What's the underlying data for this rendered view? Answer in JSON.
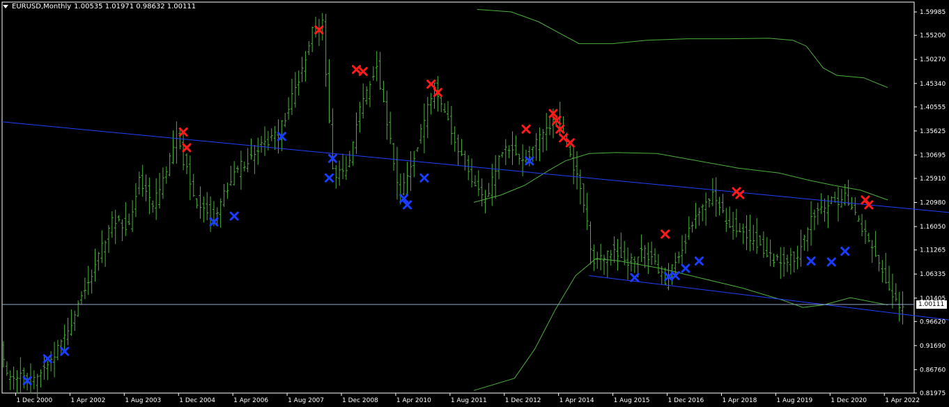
{
  "header": {
    "symbol": "EURUSD,Monthly",
    "ohlc": "1.00535 1.01971 0.98632 1.00111"
  },
  "current_price": "1.00111",
  "colors": {
    "background": "#000000",
    "candles": "#4caf3c",
    "bands": "#4caf3c",
    "channel": "#2040ff",
    "price_line": "#8fa8c8",
    "sell_marker": "#ff1a1a",
    "buy_marker": "#1a3cff",
    "axis": "#ffffff"
  },
  "chart_data": {
    "type": "bar",
    "title": "EURUSD,Monthly",
    "ylim": [
      0.8197,
      1.62
    ],
    "y_ticks": [
      "1.59985",
      "1.55200",
      "1.50270",
      "1.45340",
      "1.40555",
      "1.35625",
      "1.30695",
      "1.25910",
      "1.20980",
      "1.16050",
      "1.11265",
      "1.06335",
      "1.01405",
      "0.96620",
      "0.91690",
      "0.86760",
      "0.81975"
    ],
    "x_ticks": [
      "1 Dec 2000",
      "1 Apr 2002",
      "1 Aug 2003",
      "1 Dec 2004",
      "1 Apr 2006",
      "1 Aug 2007",
      "1 Dec 2008",
      "1 Apr 2010",
      "1 Aug 2011",
      "1 Dec 2012",
      "1 Apr 2014",
      "1 Aug 2015",
      "1 Dec 2016",
      "1 Apr 2018",
      "1 Aug 2019",
      "1 Dec 2020",
      "1 Apr 2022"
    ],
    "x_start": "2000-08",
    "x_end": "2022-09",
    "price_anchors": [
      [
        "2000-08",
        0.91
      ],
      [
        "2000-10",
        0.86
      ],
      [
        "2001-06",
        0.85
      ],
      [
        "2001-12",
        0.9
      ],
      [
        "2002-06",
        0.98
      ],
      [
        "2003-05",
        1.17
      ],
      [
        "2003-10",
        1.16
      ],
      [
        "2004-01",
        1.26
      ],
      [
        "2004-05",
        1.2
      ],
      [
        "2004-12",
        1.34
      ],
      [
        "2005-06",
        1.21
      ],
      [
        "2005-11",
        1.18
      ],
      [
        "2006-05",
        1.27
      ],
      [
        "2006-12",
        1.32
      ],
      [
        "2007-06",
        1.35
      ],
      [
        "2007-12",
        1.46
      ],
      [
        "2008-04",
        1.56
      ],
      [
        "2008-07",
        1.58
      ],
      [
        "2008-10",
        1.27
      ],
      [
        "2009-02",
        1.27
      ],
      [
        "2009-06",
        1.4
      ],
      [
        "2009-11",
        1.49
      ],
      [
        "2010-06",
        1.22
      ],
      [
        "2010-11",
        1.33
      ],
      [
        "2011-04",
        1.45
      ],
      [
        "2011-12",
        1.3
      ],
      [
        "2012-07",
        1.21
      ],
      [
        "2012-12",
        1.32
      ],
      [
        "2013-07",
        1.3
      ],
      [
        "2014-03",
        1.38
      ],
      [
        "2014-06",
        1.36
      ],
      [
        "2014-12",
        1.21
      ],
      [
        "2015-03",
        1.08
      ],
      [
        "2015-08",
        1.11
      ],
      [
        "2016-01",
        1.09
      ],
      [
        "2016-06",
        1.11
      ],
      [
        "2016-12",
        1.05
      ],
      [
        "2017-05",
        1.12
      ],
      [
        "2017-09",
        1.18
      ],
      [
        "2018-02",
        1.23
      ],
      [
        "2018-06",
        1.17
      ],
      [
        "2019-01",
        1.14
      ],
      [
        "2019-09",
        1.09
      ],
      [
        "2020-03",
        1.1
      ],
      [
        "2020-07",
        1.18
      ],
      [
        "2021-01",
        1.21
      ],
      [
        "2021-05",
        1.22
      ],
      [
        "2021-12",
        1.13
      ],
      [
        "2022-05",
        1.05
      ],
      [
        "2022-09",
        1.0
      ]
    ],
    "upper_band": [
      [
        "2012-04",
        1.605
      ],
      [
        "2013-02",
        1.6
      ],
      [
        "2013-10",
        1.58
      ],
      [
        "2014-06",
        1.55
      ],
      [
        "2014-10",
        1.535
      ],
      [
        "2015-08",
        1.535
      ],
      [
        "2016-06",
        1.542
      ],
      [
        "2017-06",
        1.545
      ],
      [
        "2018-06",
        1.545
      ],
      [
        "2019-06",
        1.546
      ],
      [
        "2020-01",
        1.542
      ],
      [
        "2020-05",
        1.53
      ],
      [
        "2020-10",
        1.485
      ],
      [
        "2021-02",
        1.47
      ],
      [
        "2021-10",
        1.465
      ],
      [
        "2022-05",
        1.445
      ]
    ],
    "middle_band": [
      [
        "2012-03",
        1.21
      ],
      [
        "2012-11",
        1.225
      ],
      [
        "2013-06",
        1.245
      ],
      [
        "2014-01",
        1.275
      ],
      [
        "2014-06",
        1.295
      ],
      [
        "2015-01",
        1.31
      ],
      [
        "2015-09",
        1.312
      ],
      [
        "2016-09",
        1.31
      ],
      [
        "2017-09",
        1.295
      ],
      [
        "2018-09",
        1.28
      ],
      [
        "2019-09",
        1.27
      ],
      [
        "2020-06",
        1.255
      ],
      [
        "2021-01",
        1.245
      ],
      [
        "2021-09",
        1.235
      ],
      [
        "2022-05",
        1.215
      ]
    ],
    "lower_band": [
      [
        "2012-03",
        0.825
      ],
      [
        "2013-03",
        0.85
      ],
      [
        "2013-09",
        0.91
      ],
      [
        "2014-03",
        0.99
      ],
      [
        "2014-09",
        1.06
      ],
      [
        "2015-03",
        1.095
      ],
      [
        "2015-10",
        1.09
      ],
      [
        "2016-10",
        1.075
      ],
      [
        "2017-10",
        1.055
      ],
      [
        "2018-10",
        1.035
      ],
      [
        "2019-10",
        1.01
      ],
      [
        "2020-04",
        0.995
      ],
      [
        "2020-10",
        1.0
      ],
      [
        "2021-06",
        1.015
      ],
      [
        "2022-05",
        1.0
      ]
    ],
    "channel_lines": [
      {
        "from": [
          "2000-08",
          1.375
        ],
        "to": [
          "2025-04",
          1.178
        ]
      },
      {
        "from": [
          "2015-01",
          1.06
        ],
        "to": [
          "2025-04",
          0.955
        ]
      }
    ],
    "sell_signals": [
      [
        "2005-01",
        1.354
      ],
      [
        "2005-02",
        1.322
      ],
      [
        "2008-05",
        1.563
      ],
      [
        "2009-04",
        1.482
      ],
      [
        "2009-06",
        1.478
      ],
      [
        "2011-02",
        1.452
      ],
      [
        "2011-04",
        1.435
      ],
      [
        "2013-06",
        1.36
      ],
      [
        "2014-02",
        1.392
      ],
      [
        "2014-03",
        1.378
      ],
      [
        "2014-04",
        1.36
      ],
      [
        "2014-05",
        1.342
      ],
      [
        "2014-07",
        1.332
      ],
      [
        "2016-11",
        1.145
      ],
      [
        "2018-08",
        1.232
      ],
      [
        "2018-09",
        1.226
      ],
      [
        "2021-10",
        1.215
      ],
      [
        "2021-11",
        1.205
      ]
    ],
    "buy_signals": [
      [
        "2001-03",
        0.845
      ],
      [
        "2001-09",
        0.89
      ],
      [
        "2002-02",
        0.905
      ],
      [
        "2005-10",
        1.17
      ],
      [
        "2006-04",
        1.182
      ],
      [
        "2007-06",
        1.345
      ],
      [
        "2008-08",
        1.26
      ],
      [
        "2008-09",
        1.3
      ],
      [
        "2010-06",
        1.218
      ],
      [
        "2010-07",
        1.205
      ],
      [
        "2010-12",
        1.26
      ],
      [
        "2013-07",
        1.295
      ],
      [
        "2016-02",
        1.056
      ],
      [
        "2016-12",
        1.058
      ],
      [
        "2017-02",
        1.06
      ],
      [
        "2017-05",
        1.075
      ],
      [
        "2017-09",
        1.09
      ],
      [
        "2020-06",
        1.09
      ],
      [
        "2020-12",
        1.088
      ],
      [
        "2021-04",
        1.11
      ]
    ]
  }
}
